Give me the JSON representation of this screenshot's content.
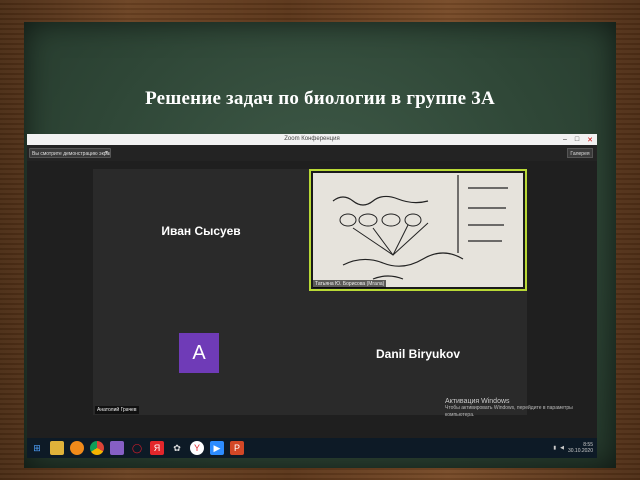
{
  "slide": {
    "title": "Решение задач по биологии в группе 3А"
  },
  "window": {
    "title": "Zoom Конференция",
    "controls": [
      "–",
      "□",
      "✕"
    ]
  },
  "toolbar": {
    "speaker_view": "Вы смотрите демонстрацию экрана",
    "grid_view": "Галерея"
  },
  "participants": [
    {
      "name": "Иван Сысуев",
      "label": ""
    },
    {
      "name": "",
      "label": "Татьяна Ю. Борисова (Мгала)"
    },
    {
      "name": "",
      "label": "Анатолий Грачев",
      "avatar_letter": "A",
      "avatar_color": "#6f3bb7"
    },
    {
      "name": "Danil Biryukov",
      "label": ""
    }
  ],
  "active_speaker_color": "#b9d936",
  "activation": {
    "heading": "Активация Windows",
    "text": "Чтобы активировать Windows, перейдите в параметры компьютера."
  },
  "taskbar": {
    "icons": [
      "windows-icon",
      "explorer-icon",
      "avast-icon",
      "chrome-icon",
      "visual-studio-icon",
      "opera-icon",
      "yandex-icon",
      "settings-icon",
      "yandex-browser-icon",
      "zoom-icon",
      "powerpoint-icon"
    ],
    "time": "8:55",
    "date": "30.10.2020"
  }
}
